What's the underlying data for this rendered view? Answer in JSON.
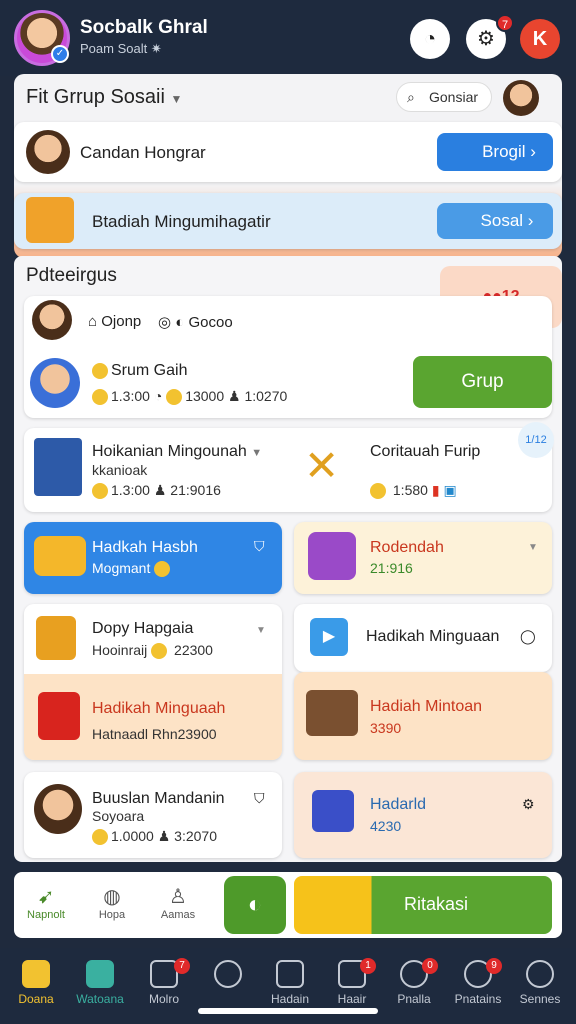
{
  "header": {
    "title": "Socbalk Ghral",
    "subtitle": "Poam Soalt ✷",
    "notif_count": "7",
    "icon_red_label": "K"
  },
  "panel": {
    "title": "Fit Grrup Sosaii",
    "search_label": "Gonsiar",
    "row1": {
      "label": "Candan Hongrar",
      "button": "Brogil"
    },
    "row2": {
      "label": "Btadiah Mingumihagatir",
      "button": "Sosal"
    }
  },
  "section": {
    "title": "Pdteeirgus",
    "promo": "●●12"
  },
  "group_card": {
    "row1": {
      "a": "Ojonp",
      "b": "Gocoo"
    },
    "row2": {
      "title": "Srum Gaih",
      "v1": "1.3:00",
      "v2": "13000",
      "v3": "1:0270",
      "button": "Grup"
    }
  },
  "tiles": [
    {
      "title": "Hoikanian Mingounah",
      "sub": "kkanioak",
      "v1": "1.3:00",
      "v2": "21:9016"
    },
    {
      "title": "Coritauah Furip",
      "v1": "1:580",
      "badge": "1/12"
    },
    {
      "title": "Hadkah Hasbh",
      "sub": "Mogmant"
    },
    {
      "title": "Rodendah",
      "sub": "21:916"
    },
    {
      "title": "Dopy Hapgaia",
      "sub": "Hooinraij",
      "v1": "22300"
    },
    {
      "title": "Hadikah Minguaan"
    },
    {
      "title": "Hadikah Minguaah",
      "sub": "Hatnaadl Rhn23900"
    },
    {
      "title": "Hadiah Mintoan",
      "sub": "3390"
    },
    {
      "title": "Buuslan Mandanin",
      "sub": "Soyoara",
      "v1": "1.0000",
      "v2": "3:2070"
    },
    {
      "title": "Hadarld",
      "sub": "4230"
    }
  ],
  "action_bar": {
    "a": "Napnolt",
    "b": "Hopa",
    "c": "Aamas",
    "cta": "Ritakasi"
  },
  "nav": [
    {
      "label": "Doana"
    },
    {
      "label": "Watoana"
    },
    {
      "label": "Molro",
      "badge": "7"
    },
    {
      "label": ""
    },
    {
      "label": "Hadain"
    },
    {
      "label": "Haair",
      "badge": "1"
    },
    {
      "label": "Pnalla",
      "badge": "0"
    },
    {
      "label": "Pnatains",
      "badge": "9"
    },
    {
      "label": "Sennes"
    }
  ]
}
